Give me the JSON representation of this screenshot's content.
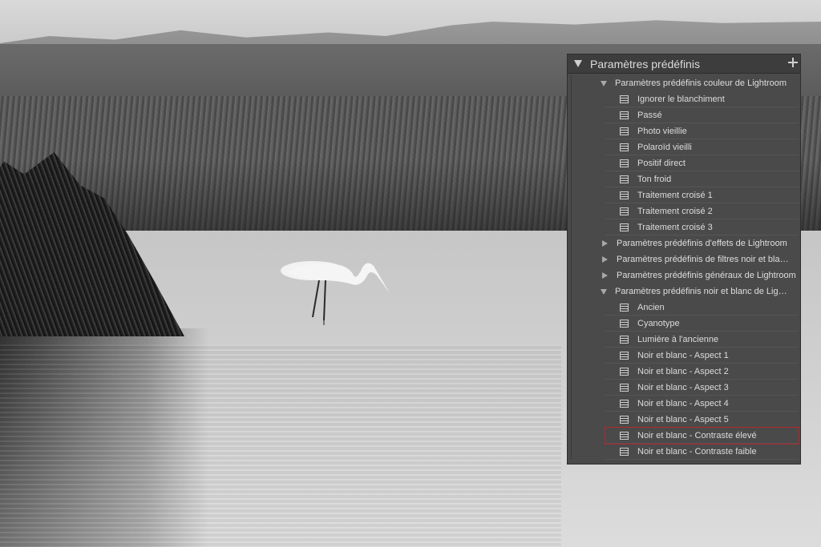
{
  "panel": {
    "title": "Paramètres prédéfinis",
    "groups": [
      {
        "label": "Paramètres prédéfinis couleur de Lightroom",
        "expanded": true,
        "items": [
          "Ignorer le blanchiment",
          "Passé",
          "Photo vieillie",
          "Polaroïd vieilli",
          "Positif direct",
          "Ton froid",
          "Traitement croisé 1",
          "Traitement croisé 2",
          "Traitement croisé 3"
        ]
      },
      {
        "label": "Paramètres prédéfinis d'effets de Lightroom",
        "expanded": false,
        "items": []
      },
      {
        "label": "Paramètres prédéfinis de filtres noir et bla…",
        "expanded": false,
        "items": []
      },
      {
        "label": "Paramètres prédéfinis généraux de Lightroom",
        "expanded": false,
        "items": []
      },
      {
        "label": "Paramètres prédéfinis noir et blanc de Lig…",
        "expanded": true,
        "items": [
          "Ancien",
          "Cyanotype",
          "Lumière à l'ancienne",
          "Noir et blanc - Aspect 1",
          "Noir et blanc - Aspect 2",
          "Noir et blanc - Aspect 3",
          "Noir et blanc - Aspect 4",
          "Noir et blanc - Aspect 5",
          "Noir et blanc - Contraste élevé",
          "Noir et blanc - Contraste faible"
        ]
      }
    ],
    "highlighted_item": "Noir et blanc - Contraste élevé",
    "highlight_color": "#b5262b"
  }
}
